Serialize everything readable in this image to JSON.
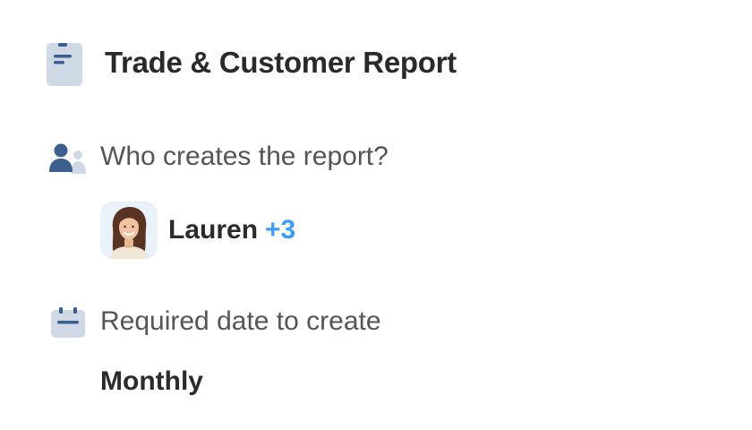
{
  "report": {
    "title": "Trade & Customer Report",
    "icon": "document-icon"
  },
  "creator": {
    "label": "Who creates the report?",
    "icon": "people-icon",
    "name": "Lauren",
    "additional": "+3",
    "avatar": "avatar-lauren"
  },
  "schedule": {
    "label": "Required date to create",
    "icon": "calendar-icon",
    "value": "Monthly"
  },
  "colors": {
    "accent": "#3d9df5",
    "icon_primary": "#3b5f8f",
    "icon_secondary": "#cfd9e6",
    "title_text": "#2a2a2a",
    "label_text": "#555555"
  }
}
